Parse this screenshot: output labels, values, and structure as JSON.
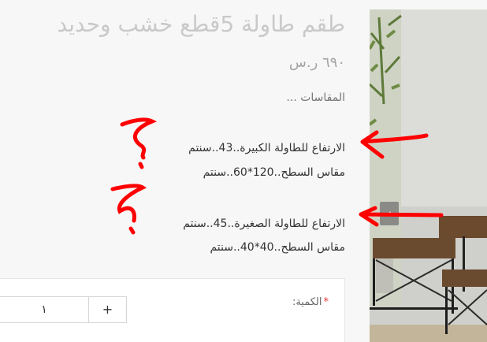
{
  "product": {
    "title": "طقم طاولة 5قطع خشب وحديد",
    "price": "٦٩٠ ر.س",
    "description": {
      "intro": "المقاسات ...",
      "large_height": "الارتفاع للطاولة الكبيرة..43..سنتم",
      "large_surface": "مقاس السطح..120*60..سنتم",
      "small_height": "الارتفاع للطاولة الصغيرة..45..سنتم",
      "small_surface": "مقاس السطح..40*40..سنتم"
    }
  },
  "quantity": {
    "label": "الكمية:",
    "required_mark": "*",
    "value": "١",
    "plus_label": "+"
  },
  "gallery": {
    "prev_arrow": "‹"
  },
  "colors": {
    "annotation": "#ff0000",
    "required": "#e53935"
  }
}
